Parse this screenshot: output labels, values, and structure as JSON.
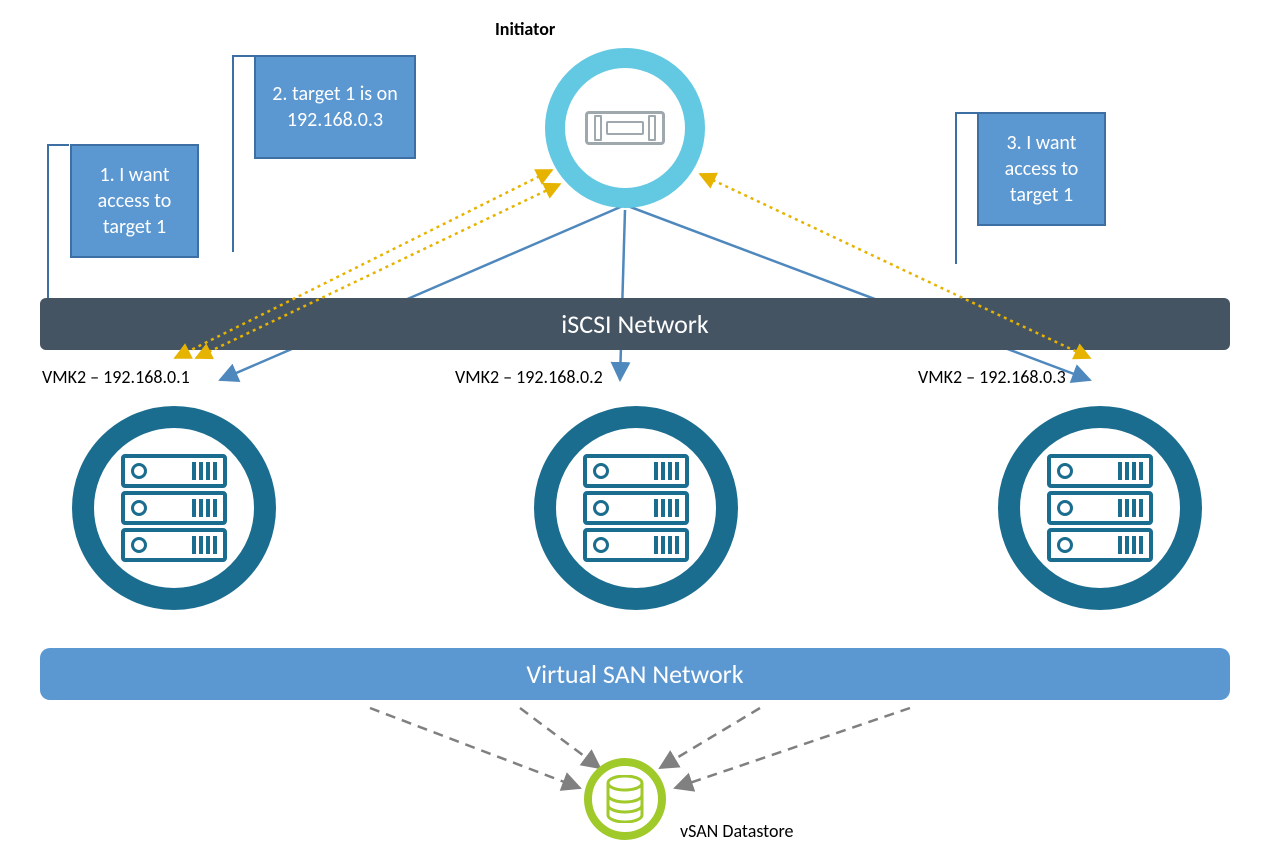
{
  "initiator_label": "Initiator",
  "callouts": {
    "c1": "1. I want access to target 1",
    "c2": "2. target 1 is on 192.168.0.3",
    "c3": "3. I want access to target 1"
  },
  "iscsi_bar": "iSCSI Network",
  "vsan_bar": "Virtual SAN Network",
  "hosts": {
    "h1": "VMK2 – 192.168.0.1",
    "h2": "VMK2 – 192.168.0.2",
    "h3": "VMK2 – 192.168.0.3"
  },
  "datastore_label": "vSAN Datastore",
  "colors": {
    "initiator_ring": "#63c8e2",
    "server_ring": "#1b6d8f",
    "callout_bg": "#5b97d1",
    "callout_border": "#3d6fa5",
    "iscsi_bar": "#445463",
    "vsan_bar": "#5b97d1",
    "dotted": "#e6b400",
    "solid_arrow": "#4f88bd",
    "dashed": "#808080",
    "datastore": "#a0c92a"
  }
}
